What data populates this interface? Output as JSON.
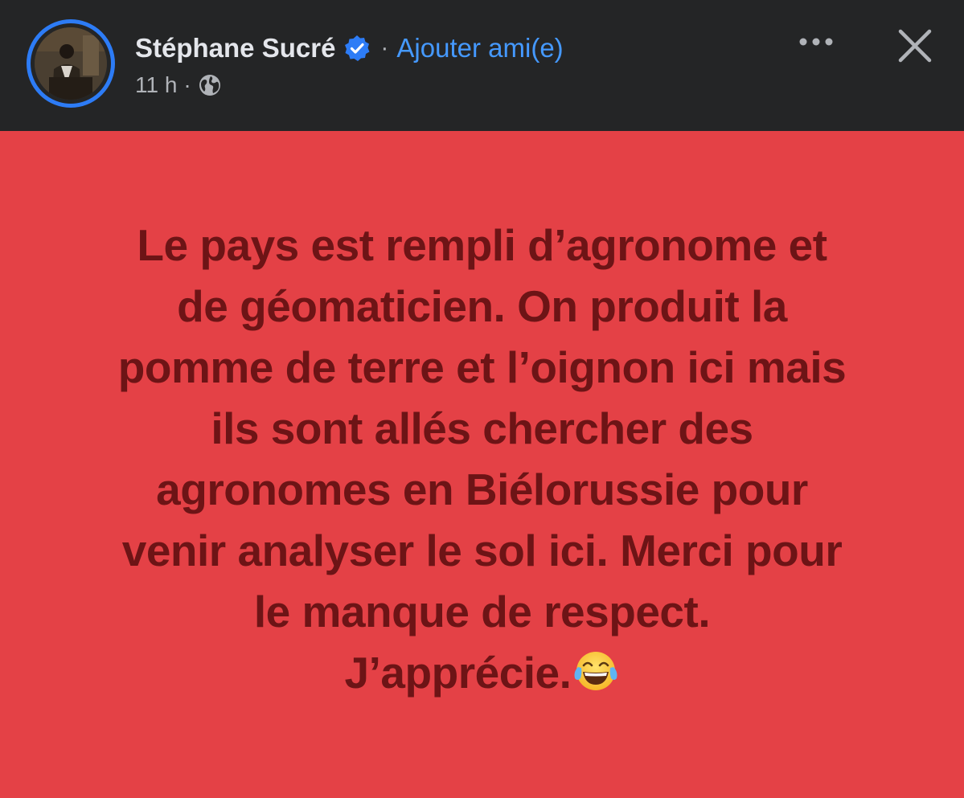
{
  "header": {
    "author_name": "Stéphane Sucré",
    "separator": "·",
    "add_friend_label": "Ajouter ami(e)",
    "timestamp": "11 h",
    "meta_separator": "·",
    "icons": {
      "verified": "verified-badge-icon",
      "audience": "globe-icon",
      "more": "more-options-icon",
      "close": "close-icon"
    }
  },
  "post": {
    "background_color": "#e44146",
    "text_color": "#6d1416",
    "lines": [
      "Le pays est rempli d’agronome et",
      "de géomaticien. On produit la",
      "pomme de terre et l’oignon ici mais",
      "ils sont allés chercher des",
      "agronomes en Biélorussie pour",
      "venir analyser le sol ici. Merci pour",
      "le manque de respect.",
      "J’apprécie."
    ],
    "trailing_emoji": "face-with-tears-of-joy"
  },
  "colors": {
    "header_bg": "#242526",
    "link_blue": "#4599ff",
    "avatar_ring": "#2d7cf6"
  }
}
